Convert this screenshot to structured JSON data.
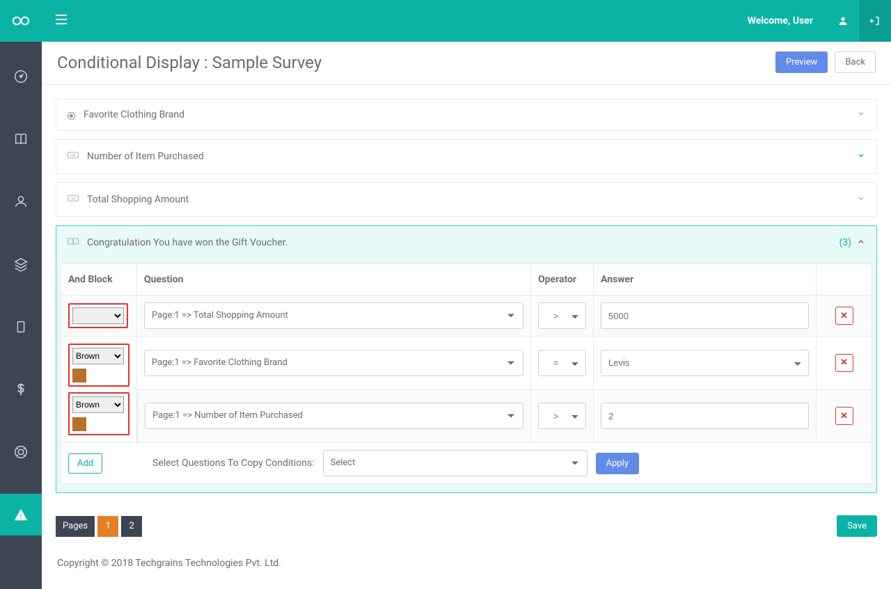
{
  "header": {
    "welcome_text": "Welcome, User"
  },
  "page": {
    "title": "Conditional Display : Sample Survey",
    "preview_label": "Preview",
    "back_label": "Back",
    "save_label": "Save"
  },
  "accordions": {
    "brand_title": "Favorite Clothing Brand",
    "items_title": "Number of Item Purchased",
    "amount_title": "Total Shopping Amount",
    "gift_title": "Congratulation You have won the Gift Voucher.",
    "gift_count": "(3)"
  },
  "table": {
    "headers": {
      "and_block": "And Block",
      "question": "Question",
      "operator": "Operator",
      "answer": "Answer"
    },
    "rows": {
      "r1": {
        "and_block": "",
        "question": "Page:1 => Total Shopping Amount",
        "operator": ">",
        "answer": "5000"
      },
      "r2": {
        "and_block": "Brown",
        "question": "Page:1 => Favorite Clothing Brand",
        "operator": "=",
        "answer": "Levis"
      },
      "r3": {
        "and_block": "Brown",
        "question": "Page:1 => Number of Item Purchased",
        "operator": ">",
        "answer": "2"
      }
    },
    "add_label": "Add",
    "copy_label": "Select Questions To Copy Conditions:",
    "copy_select_placeholder": "Select",
    "apply_label": "Apply"
  },
  "pager": {
    "label": "Pages",
    "p1": "1",
    "p2": "2"
  },
  "footer": {
    "text": "Copyright © 2018 Techgrains Technologies Pvt. Ltd."
  },
  "colors": {
    "teal": "#0bb3a6",
    "blue": "#628be8",
    "red": "#e3312f",
    "swatch": "#b5722b",
    "orange": "#e57e25"
  }
}
